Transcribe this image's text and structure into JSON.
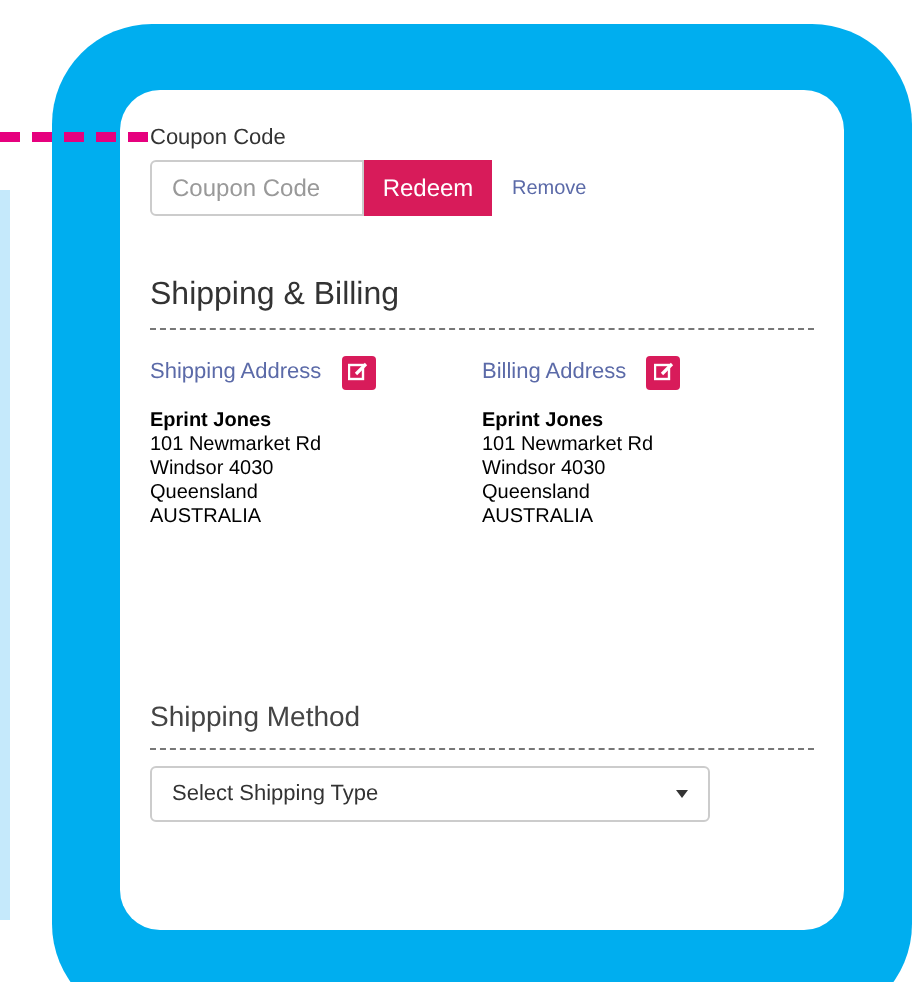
{
  "coupon": {
    "label": "Coupon Code",
    "placeholder": "Coupon Code",
    "redeem_button": "Redeem",
    "remove_link": "Remove"
  },
  "shipping_billing": {
    "heading": "Shipping & Billing",
    "addresses": [
      {
        "title": "Shipping Address",
        "lines": [
          "Eprint Jones",
          "101 Newmarket Rd",
          "Windsor 4030",
          "Queensland",
          "AUSTRALIA"
        ]
      },
      {
        "title": "Billing Address",
        "lines": [
          "Eprint Jones",
          "101 Newmarket Rd",
          "Windsor 4030",
          "Queensland",
          "AUSTRALIA"
        ]
      }
    ]
  },
  "shipping_method": {
    "heading": "Shipping Method",
    "select": {
      "value": "Select Shipping Type"
    }
  }
}
